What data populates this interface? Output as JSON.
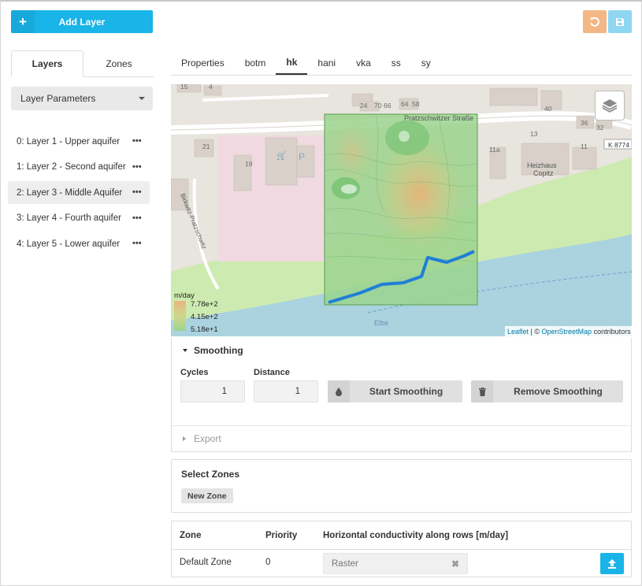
{
  "toolbar": {
    "add_layer_label": "Add Layer",
    "add_icon": "plus-icon",
    "undo_icon": "undo-icon",
    "save_icon": "save-icon",
    "undo_color": "#f3b785",
    "save_color": "#8fd6f2",
    "accent": "#19b4e8"
  },
  "left_tabs": [
    {
      "label": "Layers",
      "active": true
    },
    {
      "label": "Zones",
      "active": false
    }
  ],
  "params_dropdown": {
    "selected": "Layer Parameters"
  },
  "layers": [
    {
      "label": "0: Layer 1 - Upper aquifer",
      "more": "•••",
      "active": false
    },
    {
      "label": "1: Layer 2 - Second aquifer",
      "more": "•••",
      "active": false
    },
    {
      "label": "2: Layer 3 - Middle Aquifer",
      "more": "•••",
      "active": true
    },
    {
      "label": "3: Layer 4 - Fourth aquifer",
      "more": "•••",
      "active": false
    },
    {
      "label": "4: Layer 5 - Lower aquifer",
      "more": "•••",
      "active": false
    }
  ],
  "param_tabs": [
    {
      "label": "Properties",
      "active": false
    },
    {
      "label": "botm",
      "active": false
    },
    {
      "label": "hk",
      "active": true
    },
    {
      "label": "hani",
      "active": false
    },
    {
      "label": "vka",
      "active": false
    },
    {
      "label": "ss",
      "active": false
    },
    {
      "label": "sy",
      "active": false
    }
  ],
  "map": {
    "labels": {
      "street_north": "Pratzschwitzer Straße",
      "street_west": "Birkwitz-Pratzschwitz",
      "river": "Elbe",
      "road_ref": "K 8774",
      "heizhaus_1": "Heizhaus",
      "heizhaus_2": "Copitz",
      "h1": "15",
      "h2": "4",
      "h3": "24",
      "h4": "70",
      "h5": "66",
      "h6": "64",
      "h7": "58",
      "h8": "40",
      "h9": "36",
      "h10": "34",
      "h11": "32",
      "h12": "13",
      "h13": "11a",
      "h14": "11",
      "h15": "21",
      "h16": "19",
      "h17": "P"
    },
    "legend": {
      "unit": "m/day",
      "max": "7.78e+2",
      "mid": "4.15e+2",
      "min": "5.18e+1"
    },
    "attribution": {
      "leaflet": "Leaflet",
      "sep": " | © ",
      "osm": "OpenStreetMap",
      "suffix": " contributors"
    },
    "layers_icon": "layers-icon",
    "colors": {
      "land": "#e8e4de",
      "water": "#aad3df",
      "green": "#cdebb0",
      "river_line": "#1f7ed6"
    }
  },
  "smoothing": {
    "title": "Smoothing",
    "cycles_label": "Cycles",
    "cycles_value": "1",
    "distance_label": "Distance",
    "distance_value": "1",
    "start_label": "Start Smoothing",
    "start_icon": "droplet-icon",
    "remove_label": "Remove Smoothing",
    "remove_icon": "trash-icon"
  },
  "export": {
    "label": "Export"
  },
  "zones_select": {
    "title": "Select Zones",
    "new_zone_label": "New Zone"
  },
  "zone_table": {
    "headers": {
      "zone": "Zone",
      "priority": "Priority",
      "value": "Horizontal conductivity along rows [m/day]"
    },
    "rows": [
      {
        "zone": "Default Zone",
        "priority": "0",
        "value": "Raster",
        "clear": "✖",
        "upload_icon": "upload-icon"
      }
    ]
  }
}
